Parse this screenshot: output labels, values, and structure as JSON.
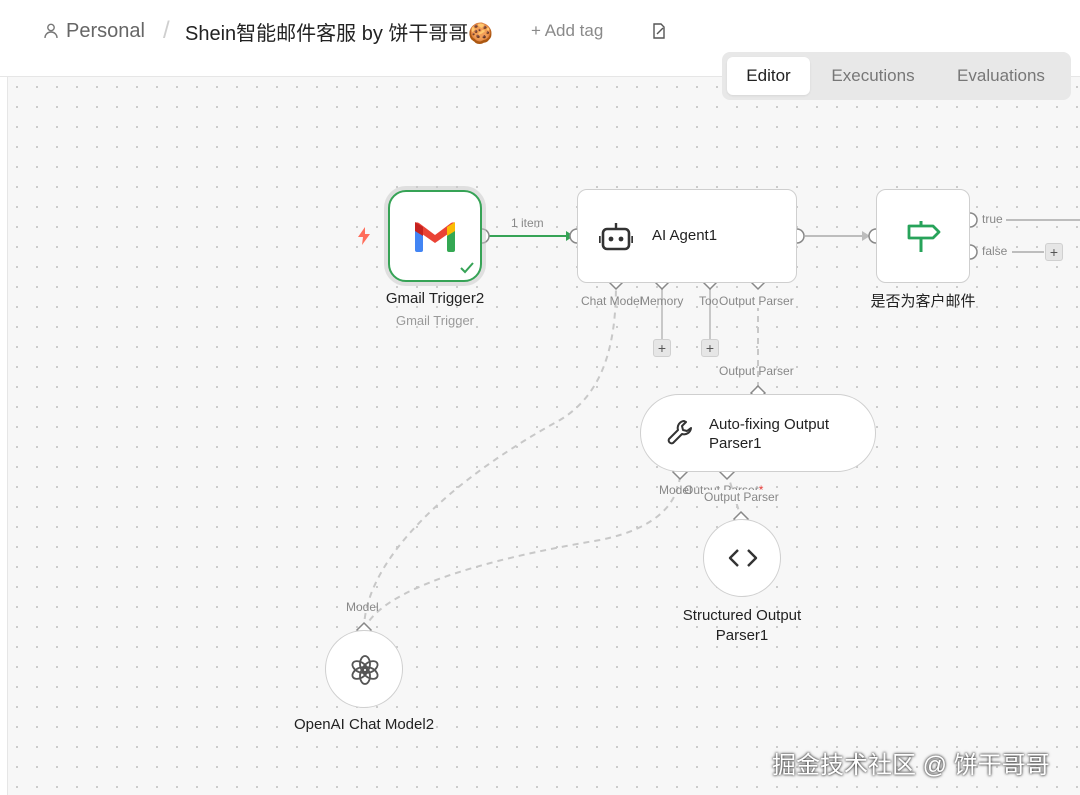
{
  "header": {
    "breadcrumb_personal": "Personal",
    "separator": "/",
    "workflow_title": "Shein智能邮件客服 by 饼干哥哥🍪",
    "add_tag": "+ Add tag"
  },
  "tabs": [
    {
      "label": "Editor",
      "active": true
    },
    {
      "label": "Executions",
      "active": false
    },
    {
      "label": "Evaluations",
      "active": false
    }
  ],
  "nodes": {
    "gmail": {
      "title": "Gmail Trigger2",
      "subtitle": "Gmail Trigger"
    },
    "agent": {
      "title": "AI Agent1",
      "ports": {
        "chat_model": "Chat Model",
        "memory": "Memory",
        "tool": "Tool",
        "output_parser": "Output Parser"
      }
    },
    "if": {
      "title": "是否为客户邮件",
      "true_label": "true",
      "false_label": "false"
    },
    "autofix": {
      "title_line1": "Auto-fixing Output",
      "title_line2": "Parser1",
      "input_label": "Output Parser",
      "ports": {
        "model": "Model",
        "output_parser": "Output Parser"
      },
      "required_mark": "*"
    },
    "structured": {
      "title_line1": "Structured Output",
      "title_line2": "Parser1",
      "input_label": "Output Parser"
    },
    "openai": {
      "title": "OpenAI Chat Model2",
      "input_label": "Model"
    }
  },
  "connections": {
    "gmail_to_agent_label": "1 item"
  },
  "plus": "+",
  "watermark": "掘金技术社区 @ 饼干哥哥",
  "colors": {
    "success": "#36a356",
    "trigger_bolt": "#ff6d5a",
    "wire": "#bdbdbd",
    "if_icon": "#27a35a"
  }
}
